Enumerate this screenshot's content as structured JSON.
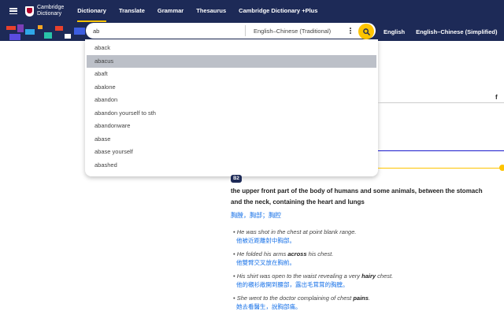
{
  "colors": {
    "navy": "#1d2a57",
    "accent_yellow": "#fec400",
    "link_blue": "#1a73e8"
  },
  "logo": {
    "line1": "Cambridge",
    "line2": "Dictionary"
  },
  "nav": [
    "Dictionary",
    "Translate",
    "Grammar",
    "Thesaurus",
    "Cambridge Dictionary +Plus"
  ],
  "search": {
    "value": "ab",
    "dictionary": "English–Chinese (Traditional)"
  },
  "languages": [
    "English",
    "English–Chinese (Simplified)"
  ],
  "suggestions": [
    "aback",
    "abacus",
    "abaft",
    "abalone",
    "abandon",
    "abandon yourself to sth",
    "abandonware",
    "abase",
    "abase yourself",
    "abashed"
  ],
  "highlighted_suggestion": "abacus",
  "social": {
    "facebook": "f"
  },
  "entry": {
    "level": "B2",
    "definition_line1": "the upper front part of the body of humans and some animals, between the stomach",
    "definition_line2": "and the neck, containing the heart and lungs",
    "translation": "胸膛，胸部；胸腔",
    "examples": [
      {
        "pre": "He was shot in the chest at point blank range.",
        "bold": "",
        "post": "",
        "zh": "他被近距離射中胸部。"
      },
      {
        "pre": "He folded his arms ",
        "bold": "across",
        "post": " his chest.",
        "zh": "他雙臂交叉放在胸前。"
      },
      {
        "pre": "His shirt was open to the waist revealing a very ",
        "bold": "hairy",
        "post": " chest.",
        "zh": "他的襯衫敞開到腰部，露出毛茸茸的胸膛。"
      },
      {
        "pre": "She went to the doctor complaining of chest ",
        "bold": "pains",
        "post": ".",
        "zh": "她去看醫生，說胸部痛。"
      }
    ]
  }
}
